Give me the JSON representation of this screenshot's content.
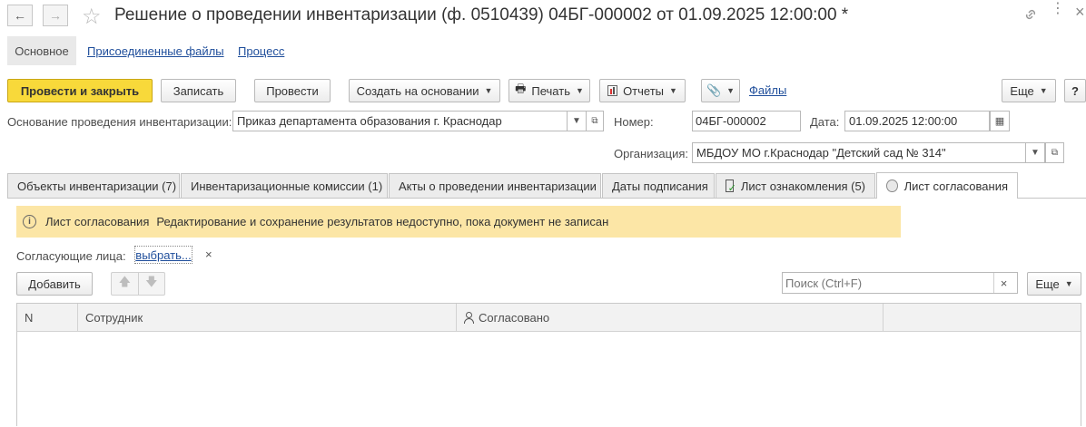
{
  "window": {
    "title": "Решение о проведении инвентаризации (ф. 0510439) 04БГ-000002 от 01.09.2025 12:00:00 *"
  },
  "top_tabs": [
    {
      "label": "Основное"
    },
    {
      "label": "Присоединенные файлы"
    },
    {
      "label": "Процесс"
    }
  ],
  "toolbar": {
    "post_close": "Провести и закрыть",
    "save": "Записать",
    "post": "Провести",
    "create_based": "Создать на основании",
    "print": "Печать",
    "reports": "Отчеты",
    "files": "Файлы",
    "more": "Еще",
    "help": "?"
  },
  "form": {
    "basis_label": "Основание проведения инвентаризации:",
    "basis_value": "Приказ департамента образования г. Краснодар",
    "number_label": "Номер:",
    "number_value": "04БГ-000002",
    "date_label": "Дата:",
    "date_value": "01.09.2025 12:00:00",
    "org_label": "Организация:",
    "org_value": "МБДОУ МО г.Краснодар \"Детский сад № 314\""
  },
  "tabs": [
    {
      "label": "Объекты инвентаризации (7)"
    },
    {
      "label": "Инвентаризационные комиссии (1)"
    },
    {
      "label": "Акты о проведении инвентаризации"
    },
    {
      "label": "Даты подписания"
    },
    {
      "label": "Лист ознакомления (5)"
    },
    {
      "label": "Лист согласования"
    }
  ],
  "warning": {
    "title": "Лист согласования",
    "text": "Редактирование и сохранение результатов недоступно, пока документ не записан"
  },
  "approvers": {
    "label": "Согласующие лица:",
    "link": "выбрать...",
    "clear": "×"
  },
  "list_toolbar": {
    "add": "Добавить",
    "search_placeholder": "Поиск (Ctrl+F)",
    "search_clear": "×",
    "more": "Еще"
  },
  "table": {
    "columns": [
      "N",
      "Сотрудник",
      "Согласовано",
      ""
    ],
    "rows": []
  },
  "colors": {
    "primary_button": "#f8d93a",
    "warning_bg": "#fce6a6",
    "link": "#1f4e9b"
  }
}
